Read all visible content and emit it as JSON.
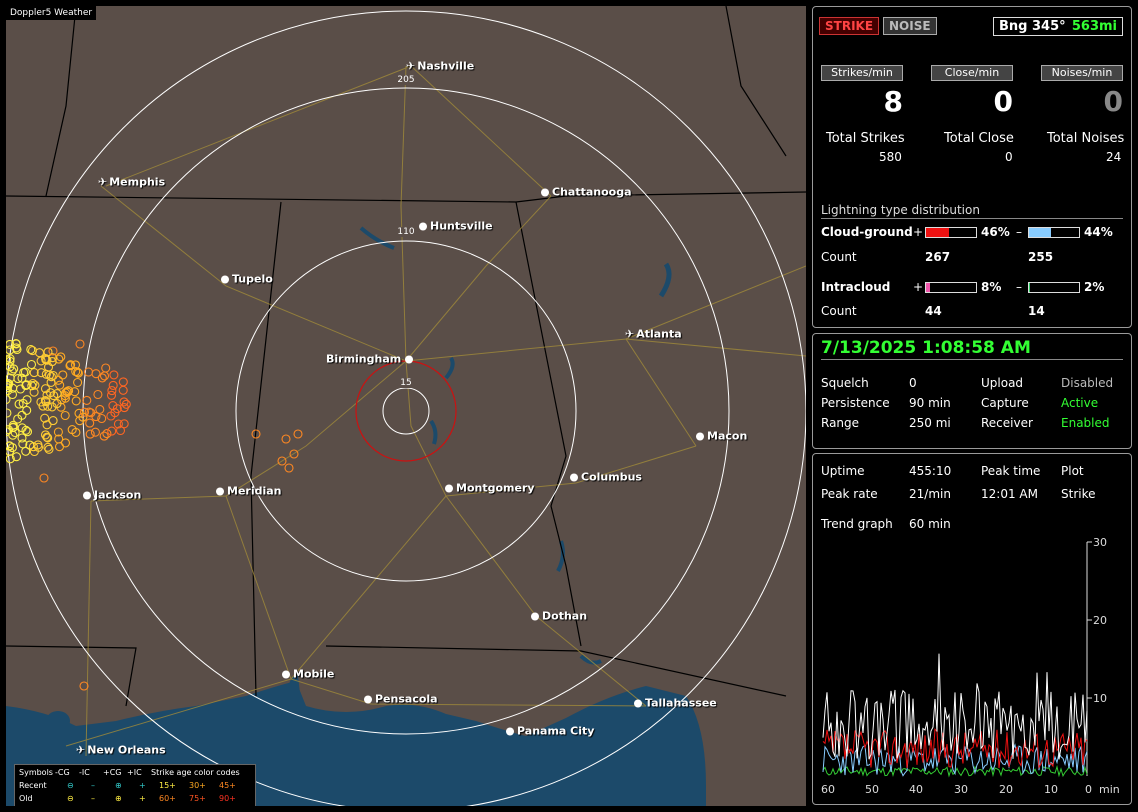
{
  "map": {
    "title": "Doppler5 Weather",
    "ring_labels": [
      "205",
      "110",
      "15"
    ],
    "cities": [
      {
        "name": "Nashville",
        "type": "airport"
      },
      {
        "name": "Memphis",
        "type": "airport"
      },
      {
        "name": "Chattanooga",
        "type": "city"
      },
      {
        "name": "Huntsville",
        "type": "city"
      },
      {
        "name": "Tupelo",
        "type": "city"
      },
      {
        "name": "Atlanta",
        "type": "airport"
      },
      {
        "name": "Birmingham",
        "type": "city"
      },
      {
        "name": "Macon",
        "type": "city"
      },
      {
        "name": "Columbus",
        "type": "city"
      },
      {
        "name": "Jackson",
        "type": "city"
      },
      {
        "name": "Meridian",
        "type": "city"
      },
      {
        "name": "Montgomery",
        "type": "city"
      },
      {
        "name": "Dothan",
        "type": "city"
      },
      {
        "name": "Mobile",
        "type": "city"
      },
      {
        "name": "Pensacola",
        "type": "city"
      },
      {
        "name": "Tallahassee",
        "type": "city"
      },
      {
        "name": "Panama City",
        "type": "city"
      },
      {
        "name": "New Orleans",
        "type": "airport"
      }
    ]
  },
  "legend": {
    "symbols": "Symbols",
    "h_cg_neg": "-CG",
    "h_ic_neg": "-IC",
    "h_cg_pos": "+CG",
    "h_ic_pos": "+IC",
    "age_codes": "Strike age color codes",
    "recent": "Recent",
    "old": "Old",
    "ages_recent": [
      "15+",
      "30+",
      "45+"
    ],
    "ages_old": [
      "60+",
      "75+",
      "90+"
    ]
  },
  "status": {
    "strike_btn": "STRIKE",
    "noise_btn": "NOISE",
    "bearing_label": "Bng 345°",
    "bearing_dist": "563mi",
    "strikes_per_min_label": "Strikes/min",
    "close_per_min_label": "Close/min",
    "noises_per_min_label": "Noises/min",
    "strikes_per_min": "8",
    "close_per_min": "0",
    "noises_per_min": "0",
    "total_strikes_label": "Total Strikes",
    "total_close_label": "Total Close",
    "total_noises_label": "Total Noises",
    "total_strikes": "580",
    "total_close": "0",
    "total_noises": "24",
    "dist_title": "Lightning type distribution",
    "cg_label": "Cloud-ground",
    "ic_label": "Intracloud",
    "count_label": "Count",
    "plus": "+",
    "minus": "–",
    "cg_pos_pct": "46%",
    "cg_neg_pct": "44%",
    "cg_pos_count": "267",
    "cg_neg_count": "255",
    "ic_pos_pct": "8%",
    "ic_neg_pct": "2%",
    "ic_pos_count": "44",
    "ic_neg_count": "14",
    "cg_pos_frac": 0.46,
    "cg_neg_frac": 0.44,
    "ic_pos_frac": 0.08,
    "ic_neg_frac": 0.02
  },
  "station": {
    "datetime": "7/13/2025 1:08:58 AM",
    "squelch_label": "Squelch",
    "squelch": "0",
    "persistence_label": "Persistence",
    "persistence": "90 min",
    "range_label": "Range",
    "range": "250 mi",
    "upload_label": "Upload",
    "upload": "Disabled",
    "capture_label": "Capture",
    "capture": "Active",
    "receiver_label": "Receiver",
    "receiver": "Enabled"
  },
  "trend": {
    "uptime_label": "Uptime",
    "uptime": "455:10",
    "peak_time_label": "Peak time",
    "peak_time": "12:01 AM",
    "plot_label": "Plot",
    "plot": "Strike",
    "peak_rate_label": "Peak rate",
    "peak_rate": "21/min",
    "trend_label": "Trend graph",
    "trend_window": "60 min",
    "y_ticks": [
      "30",
      "20",
      "10"
    ],
    "x_ticks": [
      "60",
      "50",
      "40",
      "30",
      "20",
      "10",
      "0"
    ],
    "x_unit": "min"
  },
  "colors": {
    "map_land": "#5a4e48",
    "water": "#1c4a6a",
    "strike_red": "#cc1111",
    "green_ok": "#33ff33"
  }
}
